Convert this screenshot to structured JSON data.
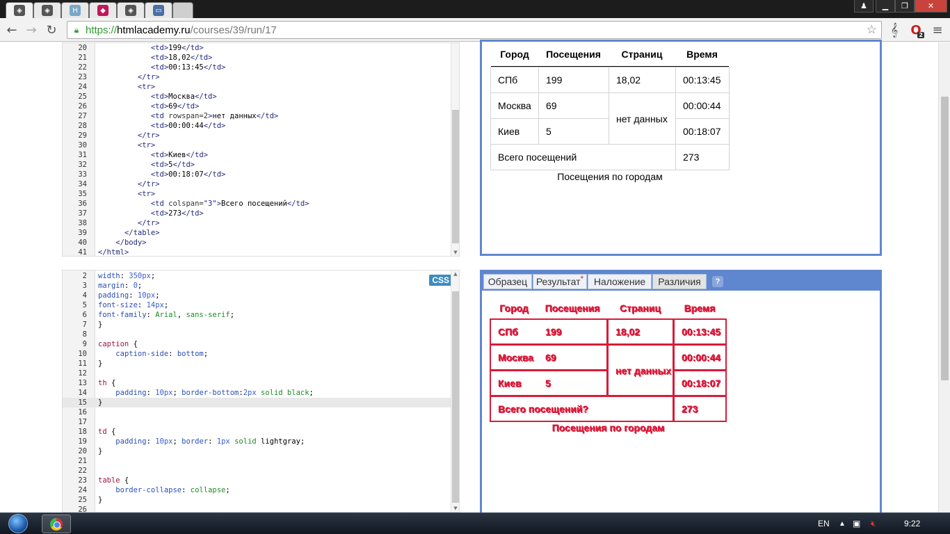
{
  "browser": {
    "url_scheme": "https://",
    "url_host": "htmlacademy.ru",
    "url_path": "/courses/39/run/17",
    "tabs": [
      {
        "icon": "htmlacademy-favicon",
        "color": "#555555",
        "glyph": "◈"
      },
      {
        "icon": "htmlacademy-favicon",
        "color": "#555555",
        "glyph": "◈"
      },
      {
        "icon": "h-favicon",
        "color": "#7aa7c7",
        "glyph": "H"
      },
      {
        "icon": "cube-favicon",
        "color": "#c2185b",
        "glyph": "◆"
      },
      {
        "icon": "htmlacademy-favicon",
        "color": "#555555",
        "glyph": "◈"
      },
      {
        "icon": "chat-favicon",
        "color": "#4a6fa5",
        "glyph": "▭"
      }
    ],
    "opera_badge": "2"
  },
  "html_editor": {
    "lines": [
      {
        "n": "20",
        "parts": [
          [
            "",
            "            "
          ],
          [
            "tag",
            "<td>"
          ],
          [
            "plain",
            "199"
          ],
          [
            "tag",
            "</td>"
          ]
        ]
      },
      {
        "n": "21",
        "parts": [
          [
            "",
            "            "
          ],
          [
            "tag",
            "<td>"
          ],
          [
            "plain",
            "18,02"
          ],
          [
            "tag",
            "</td>"
          ]
        ]
      },
      {
        "n": "22",
        "parts": [
          [
            "",
            "            "
          ],
          [
            "tag",
            "<td>"
          ],
          [
            "plain",
            "00:13:45"
          ],
          [
            "tag",
            "</td>"
          ]
        ]
      },
      {
        "n": "23",
        "parts": [
          [
            "",
            "         "
          ],
          [
            "tag",
            "</tr>"
          ]
        ]
      },
      {
        "n": "24",
        "parts": [
          [
            "",
            "         "
          ],
          [
            "tag",
            "<tr>"
          ]
        ]
      },
      {
        "n": "25",
        "parts": [
          [
            "",
            "            "
          ],
          [
            "tag",
            "<td>"
          ],
          [
            "plain",
            "Москва"
          ],
          [
            "tag",
            "</td>"
          ]
        ]
      },
      {
        "n": "26",
        "parts": [
          [
            "",
            "            "
          ],
          [
            "tag",
            "<td>"
          ],
          [
            "plain",
            "69"
          ],
          [
            "tag",
            "</td>"
          ]
        ]
      },
      {
        "n": "27",
        "parts": [
          [
            "",
            "            "
          ],
          [
            "tag",
            "<td "
          ],
          [
            "attr",
            "rowspan=2"
          ],
          [
            "tag",
            ">"
          ],
          [
            "plain",
            "нет данных"
          ],
          [
            "tag",
            "</td>"
          ]
        ]
      },
      {
        "n": "28",
        "parts": [
          [
            "",
            "            "
          ],
          [
            "tag",
            "<td>"
          ],
          [
            "plain",
            "00:00:44"
          ],
          [
            "tag",
            "</td>"
          ]
        ]
      },
      {
        "n": "29",
        "parts": [
          [
            "",
            "         "
          ],
          [
            "tag",
            "</tr>"
          ]
        ]
      },
      {
        "n": "30",
        "parts": [
          [
            "",
            "         "
          ],
          [
            "tag",
            "<tr>"
          ]
        ]
      },
      {
        "n": "31",
        "parts": [
          [
            "",
            "            "
          ],
          [
            "tag",
            "<td>"
          ],
          [
            "plain",
            "Киев"
          ],
          [
            "tag",
            "</td>"
          ]
        ]
      },
      {
        "n": "32",
        "parts": [
          [
            "",
            "            "
          ],
          [
            "tag",
            "<td>"
          ],
          [
            "plain",
            "5"
          ],
          [
            "tag",
            "</td>"
          ]
        ]
      },
      {
        "n": "33",
        "parts": [
          [
            "",
            "            "
          ],
          [
            "tag",
            "<td>"
          ],
          [
            "plain",
            "00:18:07"
          ],
          [
            "tag",
            "</td>"
          ]
        ]
      },
      {
        "n": "34",
        "parts": [
          [
            "",
            "         "
          ],
          [
            "tag",
            "</tr>"
          ]
        ]
      },
      {
        "n": "35",
        "parts": [
          [
            "",
            "         "
          ],
          [
            "tag",
            "<tr>"
          ]
        ]
      },
      {
        "n": "36",
        "parts": [
          [
            "",
            "            "
          ],
          [
            "tag",
            "<td "
          ],
          [
            "attr",
            "colspan="
          ],
          [
            "str",
            "\"3\""
          ],
          [
            "tag",
            ">"
          ],
          [
            "plain",
            "Всего посещений"
          ],
          [
            "tag",
            "</td>"
          ]
        ]
      },
      {
        "n": "37",
        "parts": [
          [
            "",
            "            "
          ],
          [
            "tag",
            "<td>"
          ],
          [
            "plain",
            "273"
          ],
          [
            "tag",
            "</td>"
          ]
        ]
      },
      {
        "n": "38",
        "parts": [
          [
            "",
            "         "
          ],
          [
            "tag",
            "</tr>"
          ]
        ]
      },
      {
        "n": "39",
        "parts": [
          [
            "",
            "      "
          ],
          [
            "tag",
            "</table>"
          ]
        ]
      },
      {
        "n": "40",
        "parts": [
          [
            "",
            "    "
          ],
          [
            "tag",
            "</body>"
          ]
        ]
      },
      {
        "n": "41",
        "parts": [
          [
            "tag",
            "</html>"
          ]
        ]
      }
    ]
  },
  "css_editor": {
    "badge": "CSS",
    "lines": [
      {
        "n": "2",
        "parts": [
          [
            "prop",
            "width"
          ],
          [
            "plain",
            ": "
          ],
          [
            "num",
            "350px"
          ],
          [
            "plain",
            ";"
          ]
        ]
      },
      {
        "n": "3",
        "parts": [
          [
            "prop",
            "margin"
          ],
          [
            "plain",
            ": "
          ],
          [
            "num",
            "0"
          ],
          [
            "plain",
            ";"
          ]
        ]
      },
      {
        "n": "4",
        "parts": [
          [
            "prop",
            "padding"
          ],
          [
            "plain",
            ": "
          ],
          [
            "num",
            "10px"
          ],
          [
            "plain",
            ";"
          ]
        ]
      },
      {
        "n": "5",
        "parts": [
          [
            "prop",
            "font-size"
          ],
          [
            "plain",
            ": "
          ],
          [
            "num",
            "14px"
          ],
          [
            "plain",
            ";"
          ]
        ]
      },
      {
        "n": "6",
        "parts": [
          [
            "prop",
            "font-family"
          ],
          [
            "plain",
            ": "
          ],
          [
            "val",
            "Arial"
          ],
          [
            "plain",
            ", "
          ],
          [
            "val",
            "sans-serif"
          ],
          [
            "plain",
            ";"
          ]
        ]
      },
      {
        "n": "7",
        "parts": [
          [
            "plain",
            "}"
          ]
        ]
      },
      {
        "n": "8",
        "parts": []
      },
      {
        "n": "9",
        "parts": [
          [
            "sel",
            "caption"
          ],
          [
            "plain",
            " {"
          ]
        ]
      },
      {
        "n": "10",
        "parts": [
          [
            "",
            "    "
          ],
          [
            "prop",
            "caption-side"
          ],
          [
            "plain",
            ": "
          ],
          [
            "prop",
            "bottom"
          ],
          [
            "plain",
            ";"
          ]
        ]
      },
      {
        "n": "11",
        "parts": [
          [
            "plain",
            "}"
          ]
        ]
      },
      {
        "n": "12",
        "parts": []
      },
      {
        "n": "13",
        "parts": [
          [
            "sel",
            "th"
          ],
          [
            "plain",
            " {"
          ]
        ]
      },
      {
        "n": "14",
        "parts": [
          [
            "",
            "    "
          ],
          [
            "prop",
            "padding"
          ],
          [
            "plain",
            ": "
          ],
          [
            "num",
            "10px"
          ],
          [
            "plain",
            "; "
          ],
          [
            "prop",
            "border-bottom"
          ],
          [
            "plain",
            ":"
          ],
          [
            "num",
            "2px"
          ],
          [
            "plain",
            " "
          ],
          [
            "val",
            "solid"
          ],
          [
            "plain",
            " "
          ],
          [
            "val",
            "black"
          ],
          [
            "plain",
            ";"
          ]
        ]
      },
      {
        "n": "15",
        "parts": [
          [
            "plain",
            "}"
          ]
        ],
        "hl": true
      },
      {
        "n": "16",
        "parts": []
      },
      {
        "n": "17",
        "parts": []
      },
      {
        "n": "18",
        "parts": [
          [
            "sel",
            "td"
          ],
          [
            "plain",
            " {"
          ]
        ]
      },
      {
        "n": "19",
        "parts": [
          [
            "",
            "    "
          ],
          [
            "prop",
            "padding"
          ],
          [
            "plain",
            ": "
          ],
          [
            "num",
            "10px"
          ],
          [
            "plain",
            "; "
          ],
          [
            "prop",
            "border"
          ],
          [
            "plain",
            ": "
          ],
          [
            "num",
            "1px"
          ],
          [
            "plain",
            " "
          ],
          [
            "val",
            "solid"
          ],
          [
            "plain",
            " "
          ],
          [
            "plain",
            "lightgray"
          ],
          [
            "plain",
            ";"
          ]
        ]
      },
      {
        "n": "20",
        "parts": [
          [
            "plain",
            "}"
          ]
        ]
      },
      {
        "n": "21",
        "parts": []
      },
      {
        "n": "22",
        "parts": []
      },
      {
        "n": "23",
        "parts": [
          [
            "sel",
            "table"
          ],
          [
            "plain",
            " {"
          ]
        ]
      },
      {
        "n": "24",
        "parts": [
          [
            "",
            "    "
          ],
          [
            "prop",
            "border-collapse"
          ],
          [
            "plain",
            ": "
          ],
          [
            "val",
            "collapse"
          ],
          [
            "plain",
            ";"
          ]
        ]
      },
      {
        "n": "25",
        "parts": [
          [
            "plain",
            "}"
          ]
        ]
      },
      {
        "n": "26",
        "parts": []
      }
    ]
  },
  "result_table": {
    "headers": [
      "Город",
      "Посещения",
      "Страниц",
      "Время"
    ],
    "rows": [
      [
        "СПб",
        "199",
        "18,02",
        "00:13:45"
      ],
      [
        "Москва",
        "69",
        "нет данных",
        "00:00:44"
      ],
      [
        "Киев",
        "5",
        "00:18:07"
      ]
    ],
    "total_label": "Всего посещений",
    "total_value": "273",
    "caption": "Посещения по городам"
  },
  "compare_tabs": {
    "tabs": [
      "Образец",
      "Результат",
      "Наложение",
      "Различия"
    ],
    "changed_marker": "*",
    "help": "?"
  },
  "diff_table": {
    "headers": [
      "Город",
      "Посещения",
      "Страниц",
      "Время"
    ],
    "rows": [
      [
        "СПб",
        "199",
        "18,02",
        "00:13:45"
      ],
      [
        "Москва",
        "69",
        "нет данных",
        "00:00:44"
      ],
      [
        "Киев",
        "5",
        "00:18:07"
      ]
    ],
    "total_label": "Всего посещений?",
    "total_value": "273",
    "caption": "Посещения по городам"
  },
  "taskbar": {
    "lang": "EN",
    "time": "9:22"
  }
}
